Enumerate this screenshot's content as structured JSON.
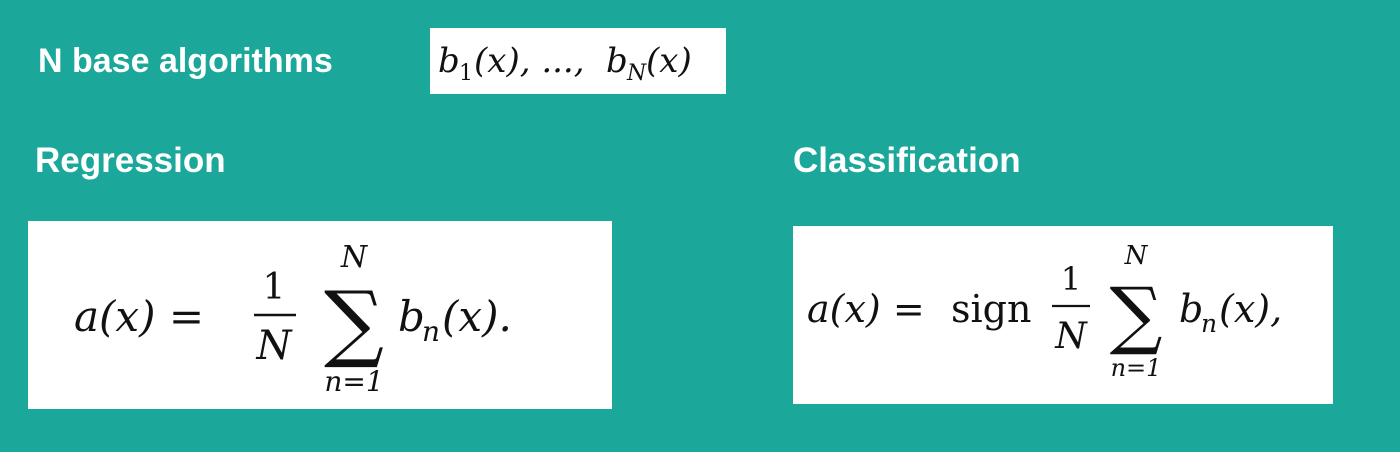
{
  "labels": {
    "base_algorithms": "N base algorithms",
    "regression": "Regression",
    "classification": "Classification"
  },
  "formulas": {
    "base": {
      "b": "b",
      "sub_first": "1",
      "arg_first": "(x), ..., ",
      "sub_last": "N",
      "arg_last": "(x)"
    },
    "regression": {
      "lhs": "a(x) =",
      "frac_num": "1",
      "frac_den": "N",
      "sum_upper": "N",
      "sum_symbol": "∑",
      "sum_lower": "n=1",
      "term_b": "b",
      "term_sub": "n",
      "term_arg": "(x)."
    },
    "classification": {
      "lhs": "a(x) =",
      "sign": "sign",
      "frac_num": "1",
      "frac_den": "N",
      "sum_upper": "N",
      "sum_symbol": "∑",
      "sum_lower": "n=1",
      "term_b": "b",
      "term_sub": "n",
      "term_arg": "(x),"
    }
  },
  "colors": {
    "background": "#1ba89b",
    "heading_text": "#ffffff",
    "formula_background": "#ffffff",
    "formula_text": "#111111"
  }
}
